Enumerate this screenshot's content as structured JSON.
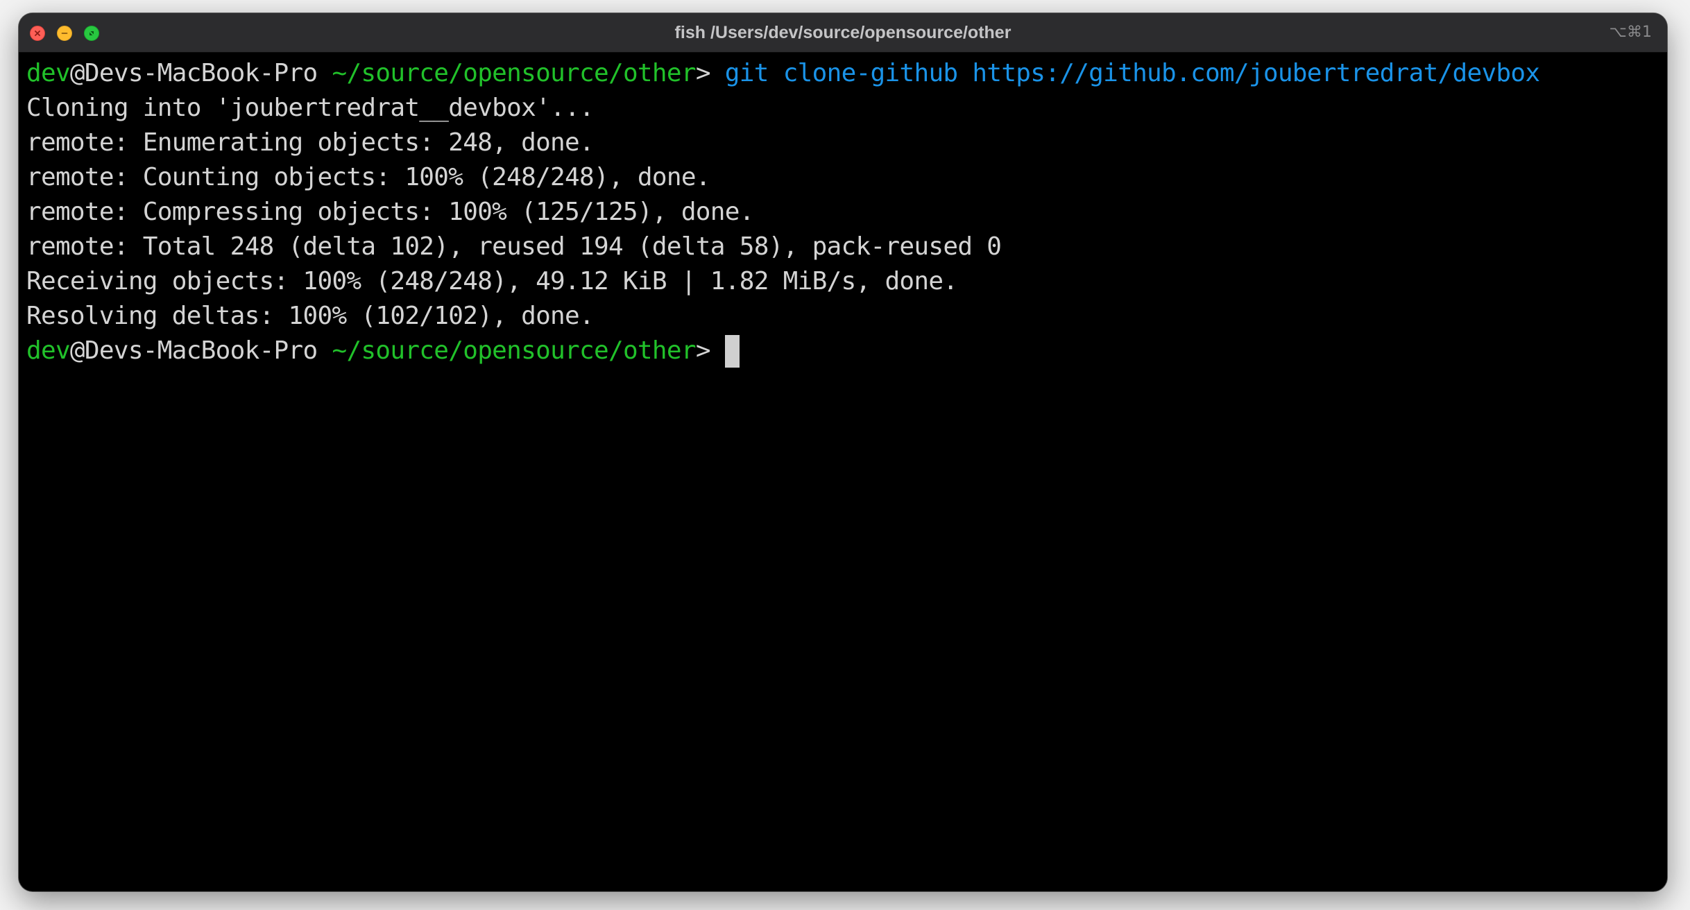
{
  "window": {
    "title": "fish /Users/dev/source/opensource/other",
    "shortcut": "⌥⌘1"
  },
  "colors": {
    "prompt_user": "#21c12a",
    "prompt_path": "#21c12a",
    "command": "#1a93e8",
    "output": "#d4d4d4",
    "background": "#000000"
  },
  "prompt": {
    "user": "dev",
    "host": "@Devs-MacBook-Pro",
    "path": "~/source/opensource/other",
    "symbol": ">"
  },
  "command": {
    "program": "git",
    "subcommand": "clone-github",
    "argument": "https://github.com/joubertredrat/devbox"
  },
  "output": [
    "Cloning into 'joubertredrat__devbox'...",
    "remote: Enumerating objects: 248, done.",
    "remote: Counting objects: 100% (248/248), done.",
    "remote: Compressing objects: 100% (125/125), done.",
    "remote: Total 248 (delta 102), reused 194 (delta 58), pack-reused 0",
    "Receiving objects: 100% (248/248), 49.12 KiB | 1.82 MiB/s, done.",
    "Resolving deltas: 100% (102/102), done."
  ]
}
